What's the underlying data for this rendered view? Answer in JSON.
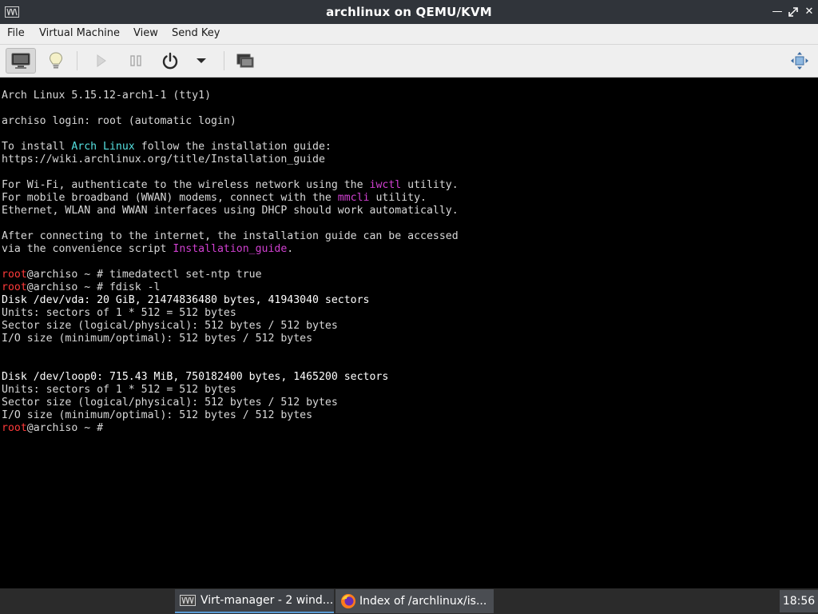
{
  "window": {
    "title": "archlinux on QEMU/KVM",
    "controls": [
      "minimize-icon",
      "maximize-icon",
      "close-icon"
    ]
  },
  "menu": {
    "file": "File",
    "virtual_machine": "Virtual Machine",
    "view": "View",
    "send_key": "Send Key"
  },
  "toolbar": {
    "icons": [
      "console-icon",
      "details-lightbulb-icon",
      "run-icon",
      "pause-icon",
      "power-icon",
      "dropdown-arrow-icon",
      "snapshots-icon",
      "resize-fullscreen-icon"
    ]
  },
  "console": {
    "lines": [
      "Arch Linux 5.15.12-arch1-1 (tty1)",
      "archiso login: root (automatic login)",
      "To install ",
      "Arch Linux",
      " follow the installation guide:",
      "https://wiki.archlinux.org/title/Installation_guide",
      "For Wi-Fi, authenticate to the wireless network using the ",
      "iwctl",
      " utility.",
      "For mobile broadband (WWAN) modems, connect with the ",
      "mmcli",
      " utility.",
      "Ethernet, WLAN and WWAN interfaces using DHCP should work automatically.",
      "After connecting to the internet, the installation guide can be accessed",
      "via the convenience script ",
      "Installation_guide",
      ".",
      "root",
      "@archiso ~ # timedatectl set-ntp true",
      "root",
      "@archiso ~ # fdisk -l",
      "Disk /dev/vda: 20 GiB, 21474836480 bytes, 41943040 sectors",
      "Units: sectors of 1 * 512 = 512 bytes",
      "Sector size (logical/physical): 512 bytes / 512 bytes",
      "I/O size (minimum/optimal): 512 bytes / 512 bytes",
      "Disk /dev/loop0: 715.43 MiB, 750182400 bytes, 1465200 sectors",
      "Units: sectors of 1 * 512 = 512 bytes",
      "Sector size (logical/physical): 512 bytes / 512 bytes",
      "I/O size (minimum/optimal): 512 bytes / 512 bytes",
      "root",
      "@archiso ~ #"
    ]
  },
  "taskbar": {
    "task1": "Virt-manager - 2 wind...",
    "task2": "Index of /archlinux/is...",
    "clock": "18:56"
  },
  "colors": {
    "console_bg": "#000000",
    "prompt_user": "#ff3a3a",
    "highlight_cyan": "#55e0e0",
    "highlight_magenta": "#d040d0"
  }
}
